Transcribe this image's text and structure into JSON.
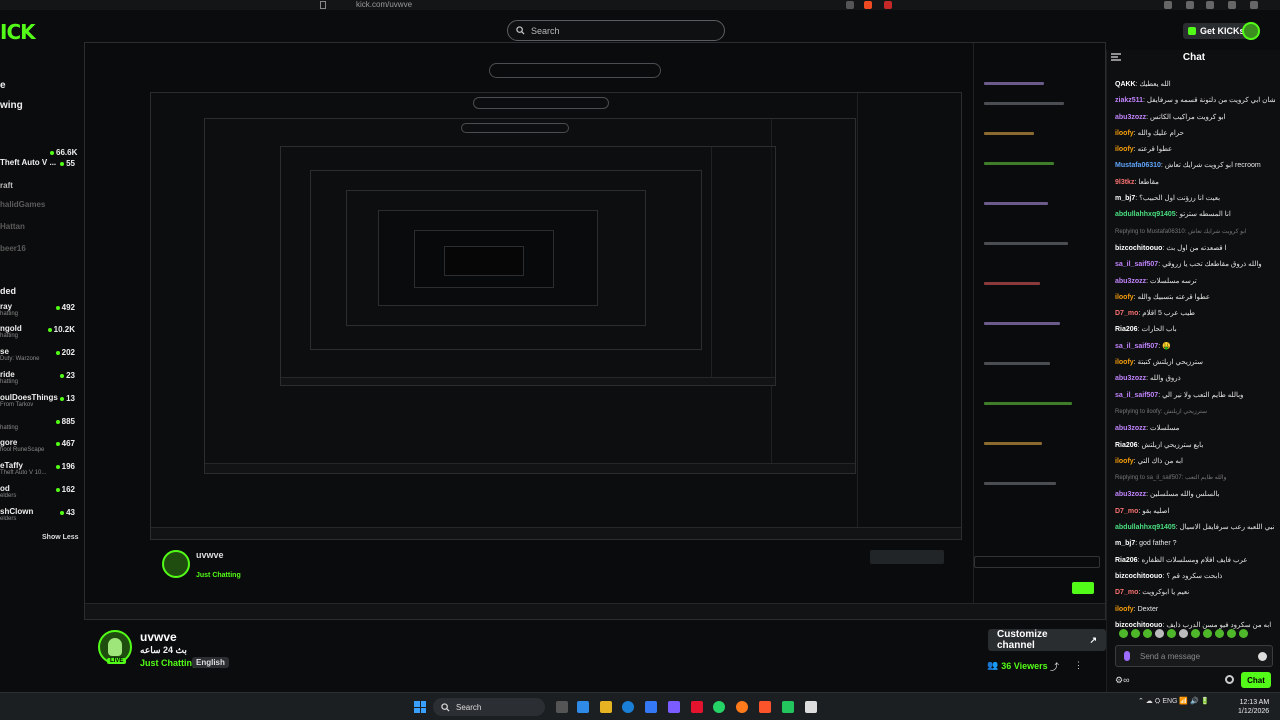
{
  "browser": {
    "url": "kick.com/uvwve"
  },
  "header": {
    "logo": "ICK",
    "search_placeholder": "Search",
    "get_kicks": "Get KICKs"
  },
  "sidebar": {
    "nav": [
      "e",
      "wing"
    ],
    "channels": [
      {
        "name": "Theft Auto V ...",
        "viewers": "55",
        "sub": ""
      },
      {
        "name": "raft",
        "viewers": "",
        "sub": ""
      },
      {
        "name": "halidGames",
        "viewers": "",
        "sub": ""
      },
      {
        "name": "Hattan",
        "viewers": "",
        "sub": ""
      },
      {
        "name": "beer16",
        "viewers": "",
        "sub": ""
      }
    ],
    "top_count": "66.6K",
    "recommended_title": "ded",
    "recommended": [
      {
        "name": "ray",
        "sub": "hatting",
        "viewers": "492"
      },
      {
        "name": "ngold",
        "sub": "hatting",
        "viewers": "10.2K"
      },
      {
        "name": "se",
        "sub": "Duty: Warzone",
        "viewers": "202"
      },
      {
        "name": "ride",
        "sub": "hatting",
        "viewers": "23"
      },
      {
        "name": "oulDoesThings",
        "sub": "From Tarkov",
        "viewers": "13"
      },
      {
        "name": "",
        "sub": "hatting",
        "viewers": "885"
      },
      {
        "name": "gore",
        "sub": "hool RuneScape",
        "viewers": "467"
      },
      {
        "name": "eTaffy",
        "sub": "Theft Auto V 10...",
        "viewers": "196"
      },
      {
        "name": "od",
        "sub": "elders",
        "viewers": "162"
      },
      {
        "name": "shClown",
        "sub": "elders",
        "viewers": "43"
      }
    ],
    "show_less": "Show Less"
  },
  "stream": {
    "streamer": "uvwve",
    "title": "بث 24 ساعه",
    "category": "Just Chatting",
    "language": "English",
    "live_badge": "LIVE",
    "customize_label": "Customize channel",
    "viewers": "36 Viewers"
  },
  "chat": {
    "title": "Chat",
    "messages": [
      {
        "user": "QAKK",
        "color": "#ffffff",
        "text": "الله يعطيك"
      },
      {
        "user": "ziakz511",
        "color": "#c084fc",
        "text": "وش افضل لعبه عشان ابي كرويت من دلتونة قسمه و سرفايفل"
      },
      {
        "user": "abu3zozz",
        "color": "#c084fc",
        "text": "ابو كرويت مراكيب الكاتس"
      },
      {
        "user": "iloofy",
        "color": "#f59e0b",
        "text": "حرام عليك والله"
      },
      {
        "user": "iloofy",
        "color": "#f59e0b",
        "text": "عطوا قرعته"
      },
      {
        "user": "Mustafa06310",
        "color": "#60a5fa",
        "text": "ابو كرويت شرايك تعاش recroom"
      },
      {
        "user": "9l3tkz",
        "color": "#f87171",
        "text": "مقاطعا"
      },
      {
        "user": "m_bj7",
        "color": "#ffffff",
        "text": "بعيت انا رزؤنت اول الحبيب؟"
      },
      {
        "user": "abdullahhxq91405",
        "color": "#4ade80",
        "text": "انا المسطه سترتو"
      },
      {
        "user": "",
        "color": "#777777",
        "text": "Replying to Mustafa06310: ابو كرويت شرايك تعاش"
      },
      {
        "user": "bizcochitoouo",
        "color": "#ffffff",
        "text": "ا قصعدته من اول بث"
      },
      {
        "user": "sa_il_saif507",
        "color": "#c084fc",
        "text": "والله ذروق مقاطعك تحب يا زروقي"
      },
      {
        "user": "abu3zozz",
        "color": "#c084fc",
        "text": "ترسه مسلسلات"
      },
      {
        "user": "iloofy",
        "color": "#f59e0b",
        "text": "عطوا قرعته بتسبيك والله"
      },
      {
        "user": "D7_mo",
        "color": "#f87171",
        "text": "طيب عرب 5 اقلام"
      },
      {
        "user": "Ria206",
        "color": "#ffffff",
        "text": "باب الحارات"
      },
      {
        "user": "sa_il_saif507",
        "color": "#c084fc",
        "text": "🤑"
      },
      {
        "user": "iloofy",
        "color": "#f59e0b",
        "text": "سترزيحي ازيلتش كتبتة"
      },
      {
        "user": "abu3zozz",
        "color": "#c084fc",
        "text": "ذروق والله"
      },
      {
        "user": "sa_il_saif507",
        "color": "#c084fc",
        "text": "وبالله طايم التعب ولا نير الي"
      },
      {
        "user": "",
        "color": "#777777",
        "text": "Replying to iloofy: سترزيحي ازيلتش"
      },
      {
        "user": "abu3zozz",
        "color": "#c084fc",
        "text": "مسلسلات"
      },
      {
        "user": "Ria206",
        "color": "#ffffff",
        "text": "بايع سترزيحي ازيلتش"
      },
      {
        "user": "iloofy",
        "color": "#f59e0b",
        "text": "ابه من ذاك التي"
      },
      {
        "user": "",
        "color": "#777777",
        "text": "Replying to sa_il_saif507: والله طايم التعب"
      },
      {
        "user": "abu3zozz",
        "color": "#c084fc",
        "text": "بالسلس والله مسلسلين"
      },
      {
        "user": "D7_mo",
        "color": "#f87171",
        "text": "اصليه بقو"
      },
      {
        "user": "abdullahhxq91405",
        "color": "#4ade80",
        "text": "الا نبي اللعبه رعب سرفايفل الاسيال Amnesia the bunker"
      },
      {
        "user": "m_bj7",
        "color": "#ffffff",
        "text": "god father ?"
      },
      {
        "user": "Ria206",
        "color": "#ffffff",
        "text": "عرب فايف افلام ومسلسلات الظفاره"
      },
      {
        "user": "bizcochitoouo",
        "color": "#ffffff",
        "text": "ذابحت سكرود قم ؟"
      },
      {
        "user": "D7_mo",
        "color": "#f87171",
        "text": "نعيم يا ابوكرويت"
      },
      {
        "user": "iloofy",
        "color": "#f59e0b",
        "text": "Dexter"
      },
      {
        "user": "bizcochitoouo",
        "color": "#ffffff",
        "text": "ابه من سكرود فيو مسن الدرب ذايف"
      }
    ],
    "input_placeholder": "Send a message",
    "send_label": "Chat"
  },
  "taskbar": {
    "search_label": "Search",
    "language": "ENG",
    "time": "12:13 AM",
    "date": "1/12/2026"
  }
}
